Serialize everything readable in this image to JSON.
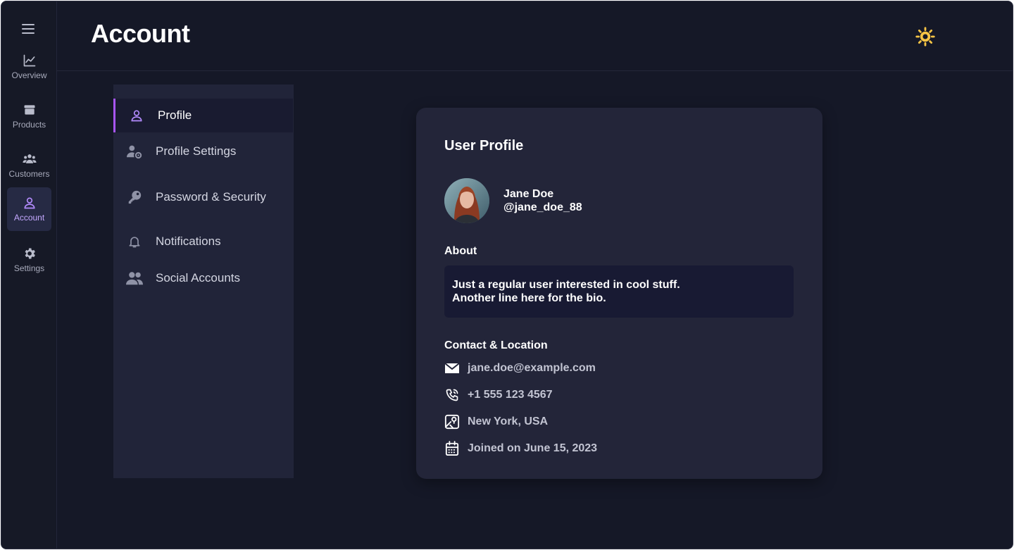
{
  "app": {
    "rail": [
      {
        "label": "Overview",
        "icon": "chart-line-icon",
        "active": false
      },
      {
        "label": "Products",
        "icon": "box-icon",
        "active": false
      },
      {
        "label": "Customers",
        "icon": "users-icon",
        "active": false
      },
      {
        "label": "Account",
        "icon": "user-icon",
        "active": true
      },
      {
        "label": "Settings",
        "icon": "gear-icon",
        "active": false
      }
    ]
  },
  "header": {
    "title": "Account",
    "theme_icon": "sun-icon"
  },
  "settings_nav": [
    {
      "label": "Profile",
      "icon": "user-outline-icon",
      "active": true
    },
    {
      "label": "Profile Settings",
      "icon": "user-gear-icon",
      "active": false
    },
    {
      "label": "Password & Security",
      "icon": "key-icon",
      "active": false
    },
    {
      "label": "Notifications",
      "icon": "bell-icon",
      "active": false
    },
    {
      "label": "Social Accounts",
      "icon": "users-icon",
      "active": false
    }
  ],
  "profile": {
    "card_title": "User Profile",
    "name": "Jane Doe",
    "handle": "@jane_doe_88",
    "about_label": "About",
    "about_line1": "Just a regular user interested in cool stuff.",
    "about_line2": "Another line here for the bio.",
    "contact_label": "Contact & Location",
    "contacts": [
      {
        "icon": "envelope-icon",
        "text": "jane.doe@example.com"
      },
      {
        "icon": "phone-icon",
        "text": "+1 555 123 4567"
      },
      {
        "icon": "map-pin-icon",
        "text": "New York, USA"
      },
      {
        "icon": "calendar-icon",
        "text": "Joined on June 15, 2023"
      }
    ]
  },
  "colors": {
    "background": "#151827",
    "panel": "#212439",
    "card": "#232539",
    "accent": "#a855f7",
    "sun": "#f6c445"
  }
}
